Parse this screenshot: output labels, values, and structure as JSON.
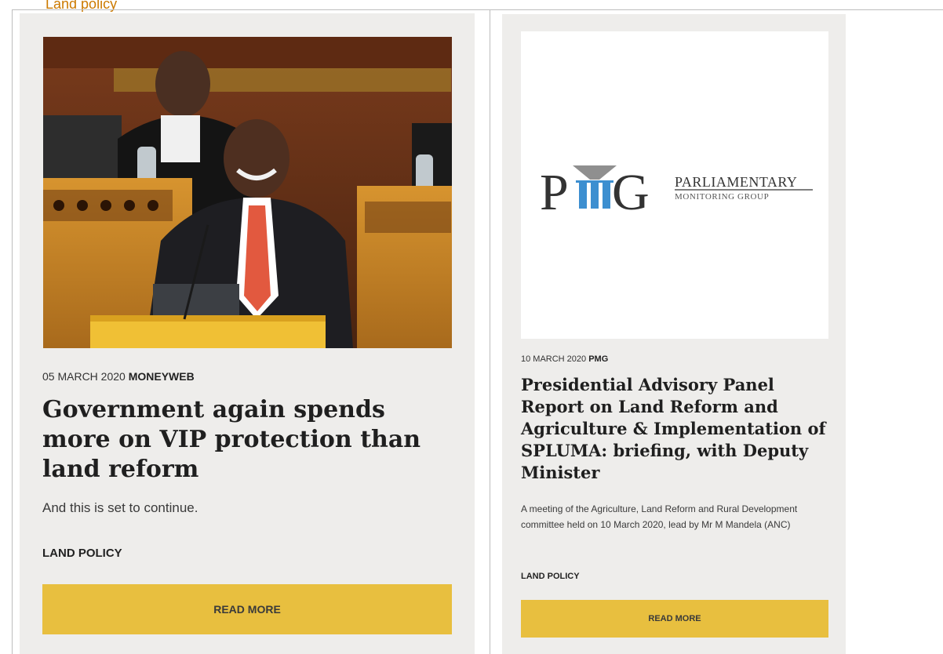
{
  "header": {
    "label": "Land policy"
  },
  "cards": [
    {
      "date": "05 MARCH 2020",
      "source": "MONEYWEB",
      "title": "Government again spends more on VIP protection than land reform",
      "excerpt": "And this is set to continue.",
      "tag": "LAND POLICY",
      "button_label": "READ MORE"
    },
    {
      "date": "10 MARCH 2020",
      "source": "PMG",
      "title": "Presidential Advisory Panel Report on Land Reform and Agriculture & Implementation of SPLUMA: briefing, with Deputy Minister",
      "excerpt": "A meeting of the Agriculture, Land Reform and Rural Development committee held on 10 March 2020, lead by Mr M Mandela (ANC)",
      "tag": "LAND POLICY",
      "button_label": "READ MORE",
      "logo": {
        "line1": "PARLIAMENTARY",
        "line2": "MONITORING GROUP"
      }
    }
  ],
  "colors": {
    "card_bg": "#eeedeb",
    "button_bg": "#e8bf3f",
    "accent_text": "#cc7a00"
  }
}
